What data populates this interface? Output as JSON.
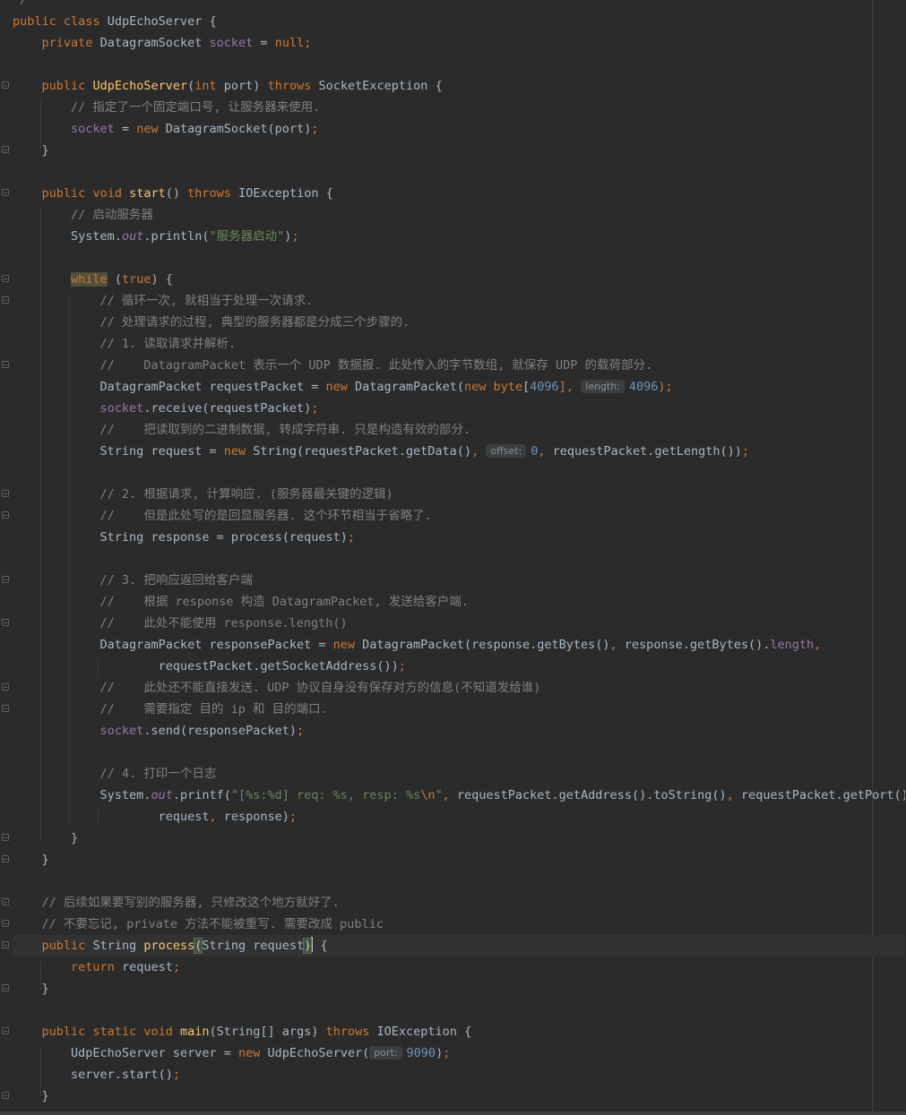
{
  "editor": {
    "top_fragment": "*/",
    "class_decl": {
      "mod1": "public",
      "mod2": "class",
      "name": "UdpEchoServer",
      "brace": "{"
    },
    "field_decl": {
      "mod": "private",
      "type": "DatagramSocket",
      "name": "socket",
      "eq": "=",
      "val": "null",
      "semi": ";"
    },
    "constructor": {
      "decl_mod": "public",
      "decl_name": "UdpEchoServer",
      "decl_params_open": "(",
      "p_type": "int",
      "p_name": "port",
      "decl_close": ")",
      "throws": "throws",
      "exc": "SocketException",
      "brace": "{",
      "comment": "// 指定了一个固定端口号, 让服务器来使用.",
      "assign_field": "socket",
      "assign_eq": "=",
      "assign_new": "new",
      "assign_rhs": "DatagramSocket(port)",
      "semi": ";",
      "close": "}"
    },
    "start": {
      "decl_mod": "public",
      "decl_void": "void",
      "decl_name": "start",
      "decl_paren": "()",
      "throws": "throws",
      "exc": "IOException",
      "brace": "{",
      "comment": "// 启动服务器",
      "print_system": "System.",
      "print_out": "out",
      "print_call": ".println(",
      "print_str": "\"服务器启动\"",
      "print_end": ")",
      "semi": ";",
      "while_kw": "while",
      "while_open": "(",
      "while_true": "true",
      "while_close": ") {",
      "c1": "// 循环一次, 就相当于处理一次请求.",
      "c2": "// 处理请求的过程, 典型的服务器都是分成三个步骤的.",
      "c3": "// 1. 读取请求并解析.",
      "c4": "//    DatagramPacket 表示一个 UDP 数据报. 此处传入的字节数组, 就保存 UDP 的载荷部分.",
      "rp_a": "DatagramPacket requestPacket = ",
      "rp_new": "new",
      "rp_b": " DatagramPacket(",
      "rp_new2": "new",
      "rp_byte": "byte",
      "rp_idx_open": "[",
      "rp_4096a": "4096",
      "rp_idx_close": "],",
      "rp_hint": "length:",
      "rp_4096b": "4096",
      "rp_end": ");",
      "recv_field": "socket",
      "recv_call": ".receive(requestPacket)",
      "recv_semi": ";",
      "c5": "//    把读取到的二进制数据, 转成字符串. 只是构造有效的部分.",
      "rq_a": "String request = ",
      "rq_new": "new",
      "rq_b": " String(requestPacket.getData()",
      "rq_comma": ",",
      "rq_hint": "offset:",
      "rq_zero": "0",
      "rq_comma2": ",",
      "rq_c": " requestPacket.getLength())",
      "rq_semi": ";",
      "c6": "// 2. 根据请求, 计算响应. (服务器最关键的逻辑)",
      "c7": "//    但是此处写的是回显服务器. 这个环节相当于省略了.",
      "rs_a": "String response = process(request)",
      "rs_semi": ";",
      "c8": "// 3. 把响应返回给客户端",
      "c9": "//    根据 response 构造 DatagramPacket, 发送给客户端.",
      "c10": "//    此处不能使用 response.length()",
      "sp_a": "DatagramPacket responsePacket = ",
      "sp_new": "new",
      "sp_b": " DatagramPacket(response.getBytes()",
      "sp_comma": ",",
      "sp_c": " response.getBytes().",
      "sp_len": "length",
      "sp_comma2": ",",
      "sp2_a": "requestPacket.getSocketAddress())",
      "sp2_semi": ";",
      "c11": "//    此处还不能直接发送. UDP 协议自身没有保存对方的信息(不知道发给谁)",
      "c12": "//    需要指定 目的 ip 和 目的端口.",
      "send_field": "socket",
      "send_call": ".send(responsePacket)",
      "send_semi": ";",
      "c13": "// 4. 打印一个日志",
      "pf_system": "System.",
      "pf_out": "out",
      "pf_call": ".printf(",
      "pf_str": "\"[%s:%d] req: %s, resp: %s",
      "pf_esc": "\\n",
      "pf_strend": "\"",
      "pf_comma": ",",
      "pf_b": " requestPacket.getAddress().toString()",
      "pf_comma2": ",",
      "pf_c": " requestPacket.getPort()",
      "pf_comma3": ",",
      "pf2_a": "request",
      "pf2_comma": ",",
      "pf2_b": " response)",
      "pf2_semi": ";",
      "while_end": "}",
      "close": "}"
    },
    "process": {
      "c1": "// 后续如果要写别的服务器, 只修改这个地方就好了.",
      "c2": "// 不要忘记, private 方法不能被重写. 需要改成 public",
      "decl_mod": "public",
      "decl_type": "String",
      "decl_name": "process",
      "decl_open": "(",
      "decl_params": "String request",
      "decl_close": ")",
      "brace": " {",
      "ret_kw": "return",
      "ret_val": " request",
      "ret_semi": ";",
      "close": "}"
    },
    "main": {
      "decl_mod": "public",
      "decl_static": "static",
      "decl_void": "void",
      "decl_name": "main",
      "decl_params": "(String[] args)",
      "throws": "throws",
      "exc": "IOException",
      "brace": "{",
      "s_a": "UdpEchoServer server = ",
      "s_new": "new",
      "s_b": " UdpEchoServer(",
      "s_hint": "port:",
      "s_num": "9090",
      "s_end": ")",
      "s_semi": ";",
      "st_a": "server.start()",
      "st_semi": ";",
      "close": "}"
    }
  }
}
